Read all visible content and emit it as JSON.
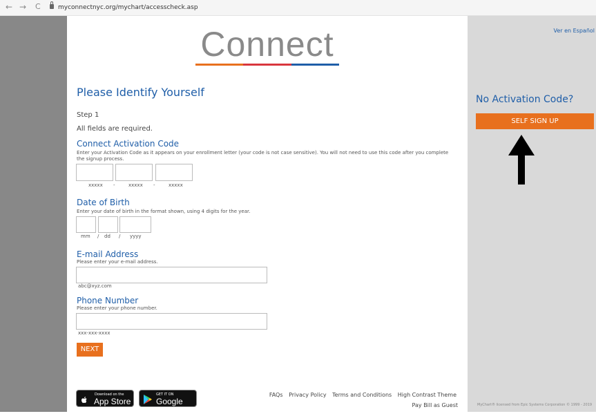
{
  "browser": {
    "url": "myconnectnyc.org/mychart/accesscheck.asp",
    "back_glyph": "←",
    "forward_glyph": "→",
    "reload_glyph": "C"
  },
  "logo": {
    "text": "Connect",
    "colors": [
      "#e8701e",
      "#d9363e",
      "#1f5ea8"
    ]
  },
  "form": {
    "title": "Please Identify Yourself",
    "step": "Step 1",
    "required_note": "All fields are required.",
    "activation": {
      "title": "Connect Activation Code",
      "hint": "Enter your Activation Code as it appears on your enrollment letter (your code is not case sensitive). You will not need to use this code after you complete the signup process.",
      "placeholders": [
        "xxxxx",
        "xxxxx",
        "xxxxx"
      ],
      "separator": "-"
    },
    "dob": {
      "title": "Date of Birth",
      "hint": "Enter your date of birth in the format shown, using 4 digits for the year.",
      "placeholders": [
        "mm",
        "dd",
        "yyyy"
      ],
      "separator": "/"
    },
    "email": {
      "title": "E-mail Address",
      "hint": "Please enter your e-mail address.",
      "example": "abc@xyz.com"
    },
    "phone": {
      "title": "Phone Number",
      "hint": "Please enter your phone number.",
      "example": "xxx-xxx-xxxx"
    },
    "next_label": "NEXT"
  },
  "badges": {
    "app_store_small": "Download on the",
    "app_store_big": "App Store",
    "google_play_small": "GET IT ON",
    "google_play_big": "Google Play"
  },
  "footer": {
    "links": [
      "FAQs",
      "Privacy Policy",
      "Terms and Conditions",
      "High Contrast Theme"
    ],
    "pay_bill": "Pay Bill as Guest"
  },
  "aside": {
    "language_link": "Ver en Español",
    "no_code_title": "No Activation Code?",
    "signup_label": "SELF SIGN UP",
    "copyright": "MyChart® licensed from Epic Systems Corporation © 1999 - 2019"
  },
  "icons": {
    "back": "back-arrow-icon",
    "forward": "forward-arrow-icon",
    "reload": "reload-icon",
    "lock": "lock-icon",
    "apple": "apple-icon",
    "play": "google-play-icon",
    "annotation": "up-arrow-icon"
  }
}
